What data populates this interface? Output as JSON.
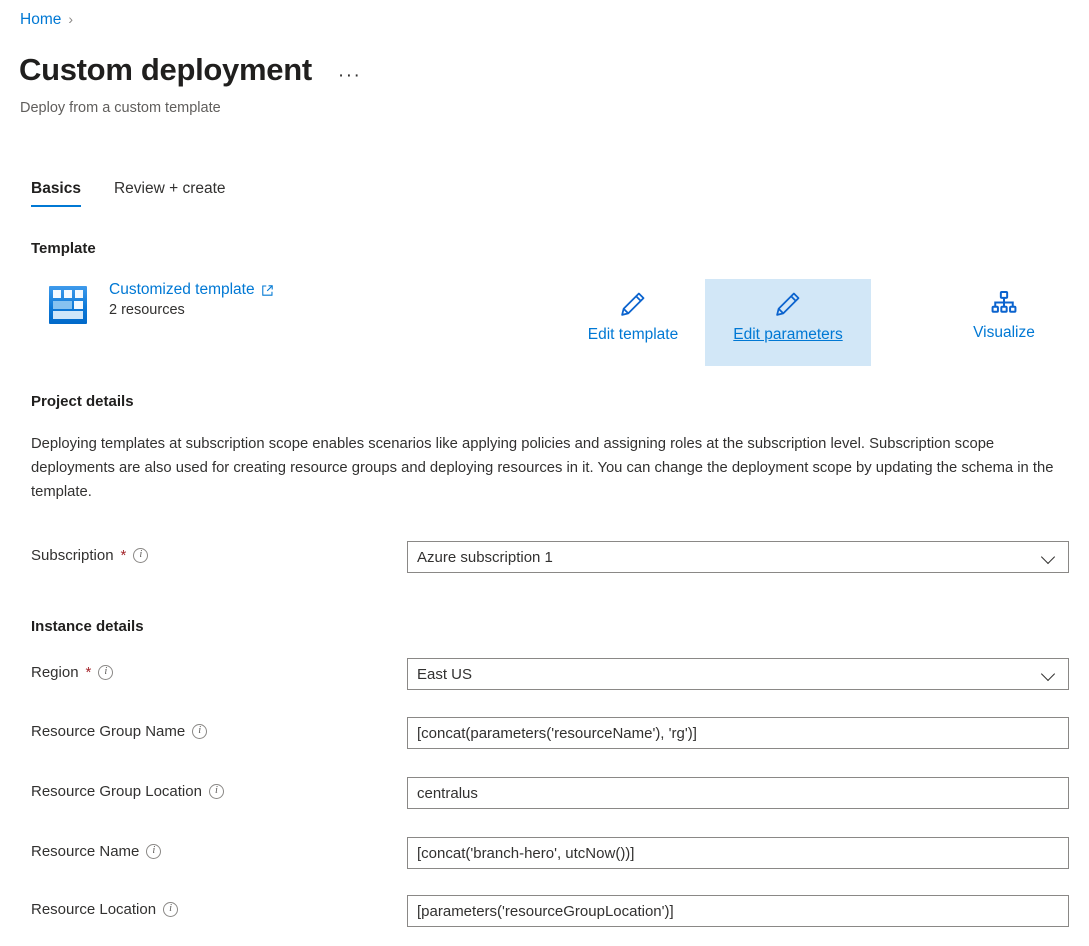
{
  "breadcrumb": {
    "home": "Home",
    "separator": "›"
  },
  "header": {
    "title": "Custom deployment",
    "subtitle": "Deploy from a custom template",
    "more_menu": "···"
  },
  "tabs": [
    {
      "label": "Basics",
      "active": true
    },
    {
      "label": "Review + create",
      "active": false
    }
  ],
  "sections": {
    "template": "Template",
    "project_details": "Project details",
    "instance_details": "Instance details"
  },
  "template": {
    "link_label": "Customized template",
    "resource_count": "2 resources",
    "icon": "template-tile-icon",
    "external_link_icon": "external-link-icon",
    "actions": [
      {
        "label": "Edit template",
        "icon": "pencil-icon",
        "highlighted": false
      },
      {
        "label": "Edit parameters",
        "icon": "pencil-icon",
        "highlighted": true
      },
      {
        "label": "Visualize",
        "icon": "hierarchy-icon",
        "highlighted": false
      }
    ]
  },
  "project_description": "Deploying templates at subscription scope enables scenarios like applying policies and assigning roles at the subscription level. Subscription scope deployments are also used for creating resource groups and deploying resources in it. You can change the deployment scope by updating the schema in the template.",
  "fields": {
    "subscription": {
      "label": "Subscription",
      "required": "*",
      "info": "i",
      "value": "Azure subscription 1",
      "type": "select"
    },
    "region": {
      "label": "Region",
      "required": "*",
      "info": "i",
      "value": "East US",
      "type": "select"
    },
    "resource_group_name": {
      "label": "Resource Group Name",
      "info": "i",
      "value": "[concat(parameters('resourceName'), 'rg')]",
      "type": "text"
    },
    "resource_group_location": {
      "label": "Resource Group Location",
      "info": "i",
      "value": "centralus",
      "type": "text"
    },
    "resource_name": {
      "label": "Resource Name",
      "info": "i",
      "value": "[concat('branch-hero', utcNow())]",
      "type": "text"
    },
    "resource_location": {
      "label": "Resource Location",
      "info": "i",
      "value": "[parameters('resourceGroupLocation')]",
      "type": "text"
    }
  },
  "colors": {
    "accent": "#0078d4",
    "highlight_bg": "#d2e7f7",
    "required_red": "#a4262c",
    "text": "#323130",
    "muted": "#605e5c"
  }
}
